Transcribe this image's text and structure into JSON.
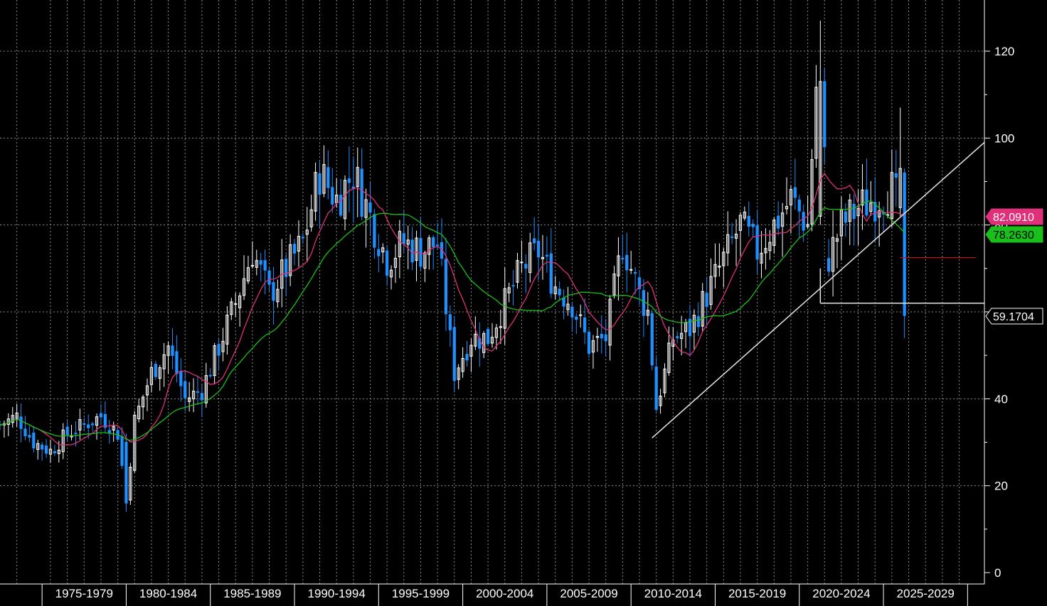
{
  "chart_data": {
    "type": "candlestick",
    "period": "quarterly",
    "x_start": 1972,
    "x_end": 2030.5,
    "ylim": [
      0,
      129
    ],
    "y_ticks": [
      0,
      20,
      40,
      60,
      80,
      100,
      120
    ],
    "y_tick_labels": [
      "0",
      "20",
      "40",
      "60",
      "80",
      "100",
      "120"
    ],
    "x_tick_labels": [
      "1975-1979",
      "1980-1984",
      "1985-1989",
      "1990-1994",
      "1995-1999",
      "2000-2004",
      "2005-2009",
      "2010-2014",
      "2015-2019",
      "2020-2024",
      "2025-2029"
    ],
    "grid": true,
    "colors": {
      "up_candle": "#ffffff",
      "down_candle": "#1e90ff",
      "ma_short": "#e0307a",
      "ma_long": "#19c019",
      "trendline": "#e6e6e6",
      "support_line": "#e6e6e6",
      "resistance_line": "#cc1111",
      "background": "#000000",
      "grid": "#8a8a8a"
    },
    "anchors": [
      [
        1972.0,
        34
      ],
      [
        1973.0,
        36
      ],
      [
        1974.0,
        30
      ],
      [
        1975.0,
        28
      ],
      [
        1976.0,
        32
      ],
      [
        1977.0,
        34
      ],
      [
        1978.0,
        36
      ],
      [
        1979.0,
        32
      ],
      [
        1979.5,
        17
      ],
      [
        1980.0,
        35
      ],
      [
        1981.0,
        46
      ],
      [
        1982.0,
        52
      ],
      [
        1983.0,
        40
      ],
      [
        1984.0,
        42
      ],
      [
        1985.0,
        52
      ],
      [
        1986.0,
        62
      ],
      [
        1987.0,
        74
      ],
      [
        1988.0,
        64
      ],
      [
        1989.0,
        70
      ],
      [
        1990.0,
        76
      ],
      [
        1991.0,
        92
      ],
      [
        1992.0,
        86
      ],
      [
        1993.0,
        92
      ],
      [
        1994.0,
        82
      ],
      [
        1995.0,
        72
      ],
      [
        1996.0,
        76
      ],
      [
        1997.0,
        74
      ],
      [
        1998.0,
        76
      ],
      [
        1999.0,
        46
      ],
      [
        2000.0,
        54
      ],
      [
        2001.0,
        54
      ],
      [
        2002.0,
        62
      ],
      [
        2003.0,
        70
      ],
      [
        2004.0,
        74
      ],
      [
        2005.0,
        66
      ],
      [
        2006.0,
        62
      ],
      [
        2007.0,
        52
      ],
      [
        2008.0,
        54
      ],
      [
        2009.0,
        76
      ],
      [
        2010.0,
        64
      ],
      [
        2010.5,
        60
      ],
      [
        2011.0,
        38
      ],
      [
        2012.0,
        54
      ],
      [
        2013.0,
        56
      ],
      [
        2014.0,
        64
      ],
      [
        2015.0,
        72
      ],
      [
        2016.0,
        80
      ],
      [
        2017.0,
        74
      ],
      [
        2018.0,
        80
      ],
      [
        2019.0,
        86
      ],
      [
        2020.0,
        80
      ],
      [
        2020.5,
        112
      ],
      [
        2021.0,
        70
      ],
      [
        2022.0,
        80
      ],
      [
        2023.0,
        84
      ],
      [
        2024.0,
        86
      ],
      [
        2025.0,
        88
      ],
      [
        2025.5,
        84
      ],
      [
        2025.75,
        59.17
      ]
    ],
    "series": [
      {
        "name": "",
        "kind": "ma",
        "color": "#e0307a",
        "last_value": 82.091
      },
      {
        "name": "",
        "kind": "ma",
        "color": "#19c019",
        "last_value": 78.263
      }
    ],
    "trendline": {
      "from": [
        2010.75,
        31
      ],
      "to": [
        2030.5,
        99
      ]
    },
    "support_line": {
      "from": [
        2020.75,
        62
      ],
      "to": [
        2030.5,
        62
      ]
    },
    "resistance_line": {
      "from": [
        2025.5,
        72.5
      ],
      "to": [
        2030.0,
        72.5
      ]
    },
    "price_tags": [
      {
        "label": "82.0910",
        "value": 82.091,
        "bg": "#e0307a",
        "fg": "#ffffff"
      },
      {
        "label": "78.2630",
        "value": 78.263,
        "bg": "#19c019",
        "fg": "#000000"
      },
      {
        "label": "59.1704",
        "value": 59.1704,
        "bg": "#000000",
        "fg": "#ffffff"
      }
    ]
  }
}
